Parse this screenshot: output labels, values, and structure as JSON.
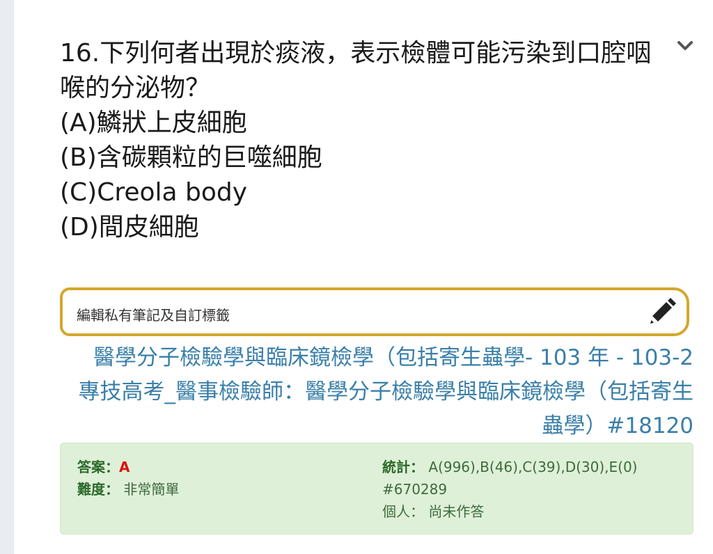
{
  "question": {
    "title": "16.下列何者出現於痰液，表示檢體可能污染到口腔咽喉的分泌物？",
    "options": [
      "(A)鱗狀上皮細胞",
      "(B)含碳顆粒的巨噬細胞",
      "(C)Creola body",
      "(D)間皮細胞"
    ]
  },
  "icons": {
    "expand": "chevron-down-icon",
    "edit": "pencil-icon"
  },
  "note": {
    "label": "編輯私有筆記及自訂標籤"
  },
  "source": {
    "text": "醫學分子檢驗學與臨床鏡檢學（包括寄生蟲學- 103 年 - 103-2 專技高考_醫事檢驗師：醫學分子檢驗學與臨床鏡檢學（包括寄生蟲學）#18120"
  },
  "answer": {
    "answer_key": "答案：",
    "answer_value": "A",
    "difficulty_key": "難度：",
    "difficulty_value": "非常簡單",
    "stats_key": "統計：",
    "stats_value": "A(996),B(46),C(39),D(30),E(0)",
    "id": "#670289",
    "personal_key": "個人：",
    "personal_value": "尚未作答"
  },
  "colors": {
    "accent_border": "#d4a72c",
    "link": "#3a7fa8",
    "answer_bg": "#dff0d8",
    "answer_red": "#d9140f"
  }
}
